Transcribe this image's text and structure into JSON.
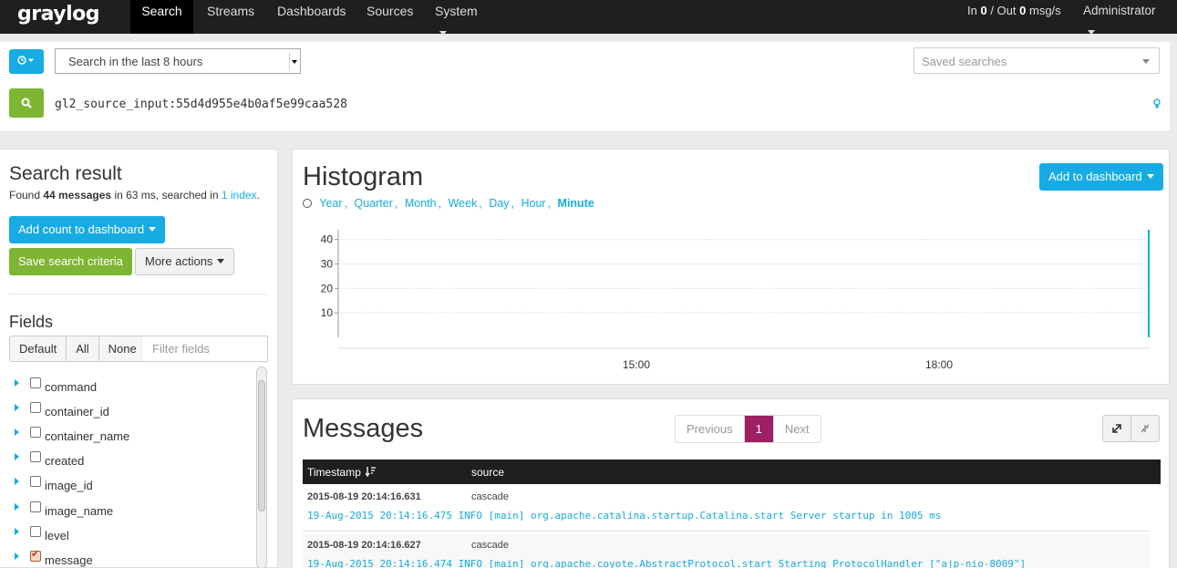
{
  "nav": {
    "logo": "graylog",
    "items": [
      {
        "label": "Search"
      },
      {
        "label": "Streams"
      },
      {
        "label": "Dashboards"
      },
      {
        "label": "Sources"
      },
      {
        "label": "System"
      }
    ],
    "throughput": {
      "in_label": "In",
      "in": "0",
      "out_label": "/ Out",
      "out": "0",
      "unit": "msg/s"
    },
    "user": "Administrator"
  },
  "search": {
    "range_label": "Search in the last 8 hours",
    "saved_searches_placeholder": "Saved searches",
    "query": "gl2_source_input:55d4d955e4b0af5e99caa528"
  },
  "result": {
    "title": "Search result",
    "found_prefix": "Found",
    "count": "44 messages",
    "timing": "in 63 ms, searched in",
    "index_link": "1 index",
    "period": ".",
    "add_count_label": "Add count to dashboard",
    "save_criteria_label": "Save search criteria",
    "more_actions_label": "More actions"
  },
  "fields": {
    "title": "Fields",
    "tabs": [
      "Default",
      "All",
      "None"
    ],
    "filter_placeholder": "Filter fields",
    "items": [
      {
        "name": "command",
        "checked": false
      },
      {
        "name": "container_id",
        "checked": false
      },
      {
        "name": "container_name",
        "checked": false
      },
      {
        "name": "created",
        "checked": false
      },
      {
        "name": "image_id",
        "checked": false
      },
      {
        "name": "image_name",
        "checked": false
      },
      {
        "name": "level",
        "checked": false
      },
      {
        "name": "message",
        "checked": true
      }
    ]
  },
  "histogram": {
    "title": "Histogram",
    "add_to_dashboard_label": "Add to dashboard",
    "resolutions": [
      "Year",
      "Quarter",
      "Month",
      "Week",
      "Day",
      "Hour",
      "Minute"
    ],
    "active_resolution": "Minute"
  },
  "chart_data": {
    "type": "bar",
    "yticks": [
      10,
      20,
      30,
      40
    ],
    "ylim": [
      0,
      44
    ],
    "xtick_labels": [
      "15:00",
      "18:00"
    ],
    "series": [
      {
        "x": "20:14",
        "value": 44
      }
    ],
    "grid": true,
    "accent": "#16ace3"
  },
  "messages": {
    "title": "Messages",
    "pager": {
      "previous": "Previous",
      "current": "1",
      "next": "Next"
    },
    "columns": [
      "Timestamp",
      "source"
    ],
    "rows": [
      {
        "timestamp": "2015-08-19 20:14:16.631",
        "source": "cascade",
        "message": "19-Aug-2015 20:14:16.475 INFO [main] org.apache.catalina.startup.Catalina.start Server startup in 1005 ms"
      },
      {
        "timestamp": "2015-08-19 20:14:16.627",
        "source": "cascade",
        "message": "19-Aug-2015 20:14:16.474 INFO [main] org.apache.coyote.AbstractProtocol.start Starting ProtocolHandler [\"ajp-nio-8009\"]"
      }
    ]
  },
  "colors": {
    "accent": "#16ace3",
    "green": "#7eb532",
    "navbar": "#1f1f1f",
    "pager_active": "#9e1f63"
  }
}
